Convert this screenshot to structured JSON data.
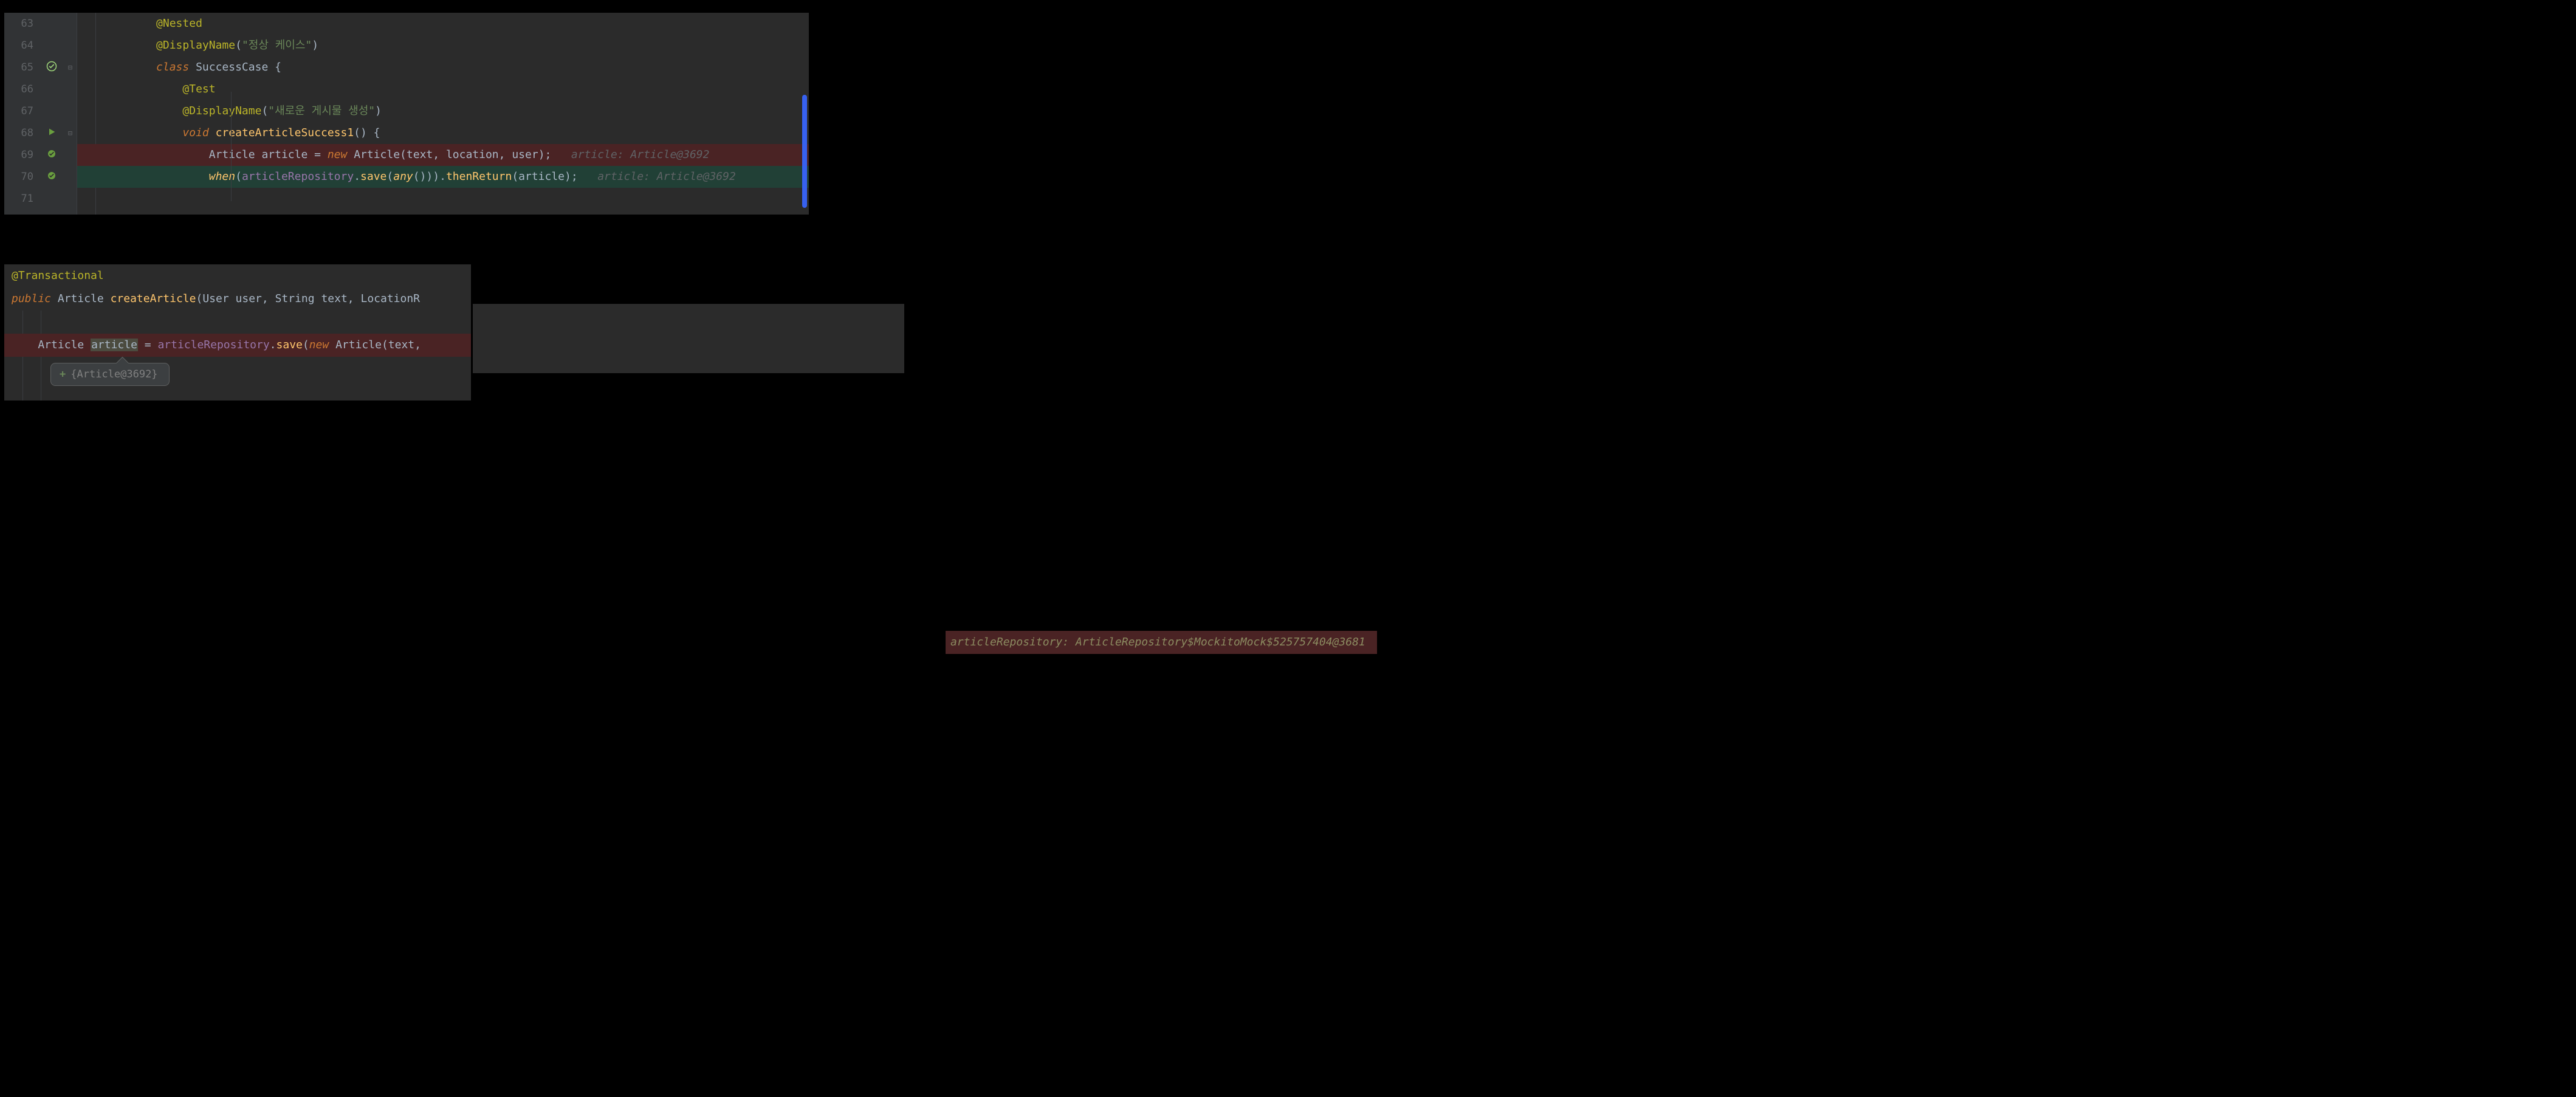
{
  "top_editor": {
    "lines": [
      {
        "num": "63",
        "icon": null
      },
      {
        "num": "64",
        "icon": null
      },
      {
        "num": "65",
        "icon": "check"
      },
      {
        "num": "66",
        "icon": null
      },
      {
        "num": "67",
        "icon": null
      },
      {
        "num": "68",
        "icon": "run"
      },
      {
        "num": "69",
        "icon": "pass"
      },
      {
        "num": "70",
        "icon": "pass"
      },
      {
        "num": "71",
        "icon": null
      }
    ],
    "code": {
      "l63_ann": "@Nested",
      "l64_ann": "@DisplayName",
      "l64_str": "\"정상 케이스\"",
      "l65_kw": "class",
      "l65_cls": "SuccessCase",
      "l66_ann": "@Test",
      "l67_ann": "@DisplayName",
      "l67_str": "\"새로운 게시물 생성\"",
      "l68_kw": "void",
      "l68_mtd": "createArticleSuccess1",
      "l69_type": "Article",
      "l69_var": "article",
      "l69_eq": " = ",
      "l69_new": "new",
      "l69_ctor": "Article",
      "l69_p1": "text",
      "l69_p2": "location",
      "l69_p3": "user",
      "l69_hint_key": "article:",
      "l69_hint_val": "Article@3692",
      "l70_when": "when",
      "l70_repo": "articleRepository",
      "l70_save": "save",
      "l70_any": "any",
      "l70_then": "thenReturn",
      "l70_arg": "article",
      "l70_hint_key": "article:",
      "l70_hint_val": "Article@3692"
    }
  },
  "bottom_editor": {
    "l1_ann": "@Transactional",
    "l2_kw": "public",
    "l2_type": "Article",
    "l2_mtd": "createArticle",
    "l2_p1t": "User",
    "l2_p1n": "user",
    "l2_p2t": "String",
    "l2_p2n": "text",
    "l2_p3t": "LocationR",
    "l4_type": "Article",
    "l4_var": "article",
    "l4_repo": "articleRepository",
    "l4_save": "save",
    "l4_new": "new",
    "l4_ctor": "Article",
    "l4_p1": "text",
    "tooltip_plus": "+",
    "tooltip_text": "{Article@3692}"
  },
  "right_hint": {
    "name": "articleRepository:",
    "value": "ArticleRepository$MockitoMock$525757404@3681"
  }
}
